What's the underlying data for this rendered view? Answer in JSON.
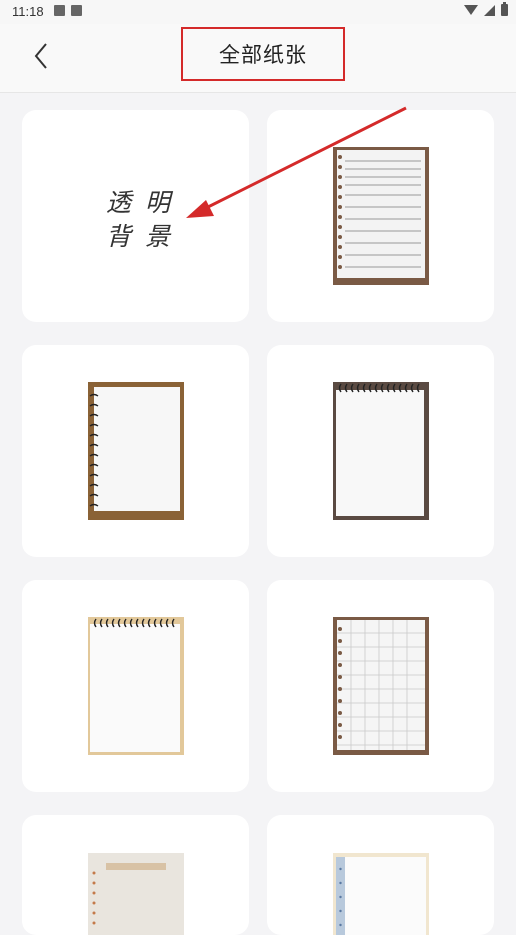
{
  "status_bar": {
    "time": "11:18"
  },
  "header": {
    "title": "全部纸张"
  },
  "papers": [
    {
      "name": "transparent-background",
      "line1": "透明",
      "line2": "背景"
    },
    {
      "name": "lined-notebook-wood"
    },
    {
      "name": "spiral-notebook-wood"
    },
    {
      "name": "spiral-notebook-dark"
    },
    {
      "name": "spiral-notebook-cream"
    },
    {
      "name": "grid-notebook-wood"
    },
    {
      "name": "beige-memo-paper"
    },
    {
      "name": "blue-margin-paper"
    }
  ],
  "colors": {
    "accent_annotation": "#d42a2a",
    "background": "#f4f4f6",
    "card": "#ffffff"
  }
}
